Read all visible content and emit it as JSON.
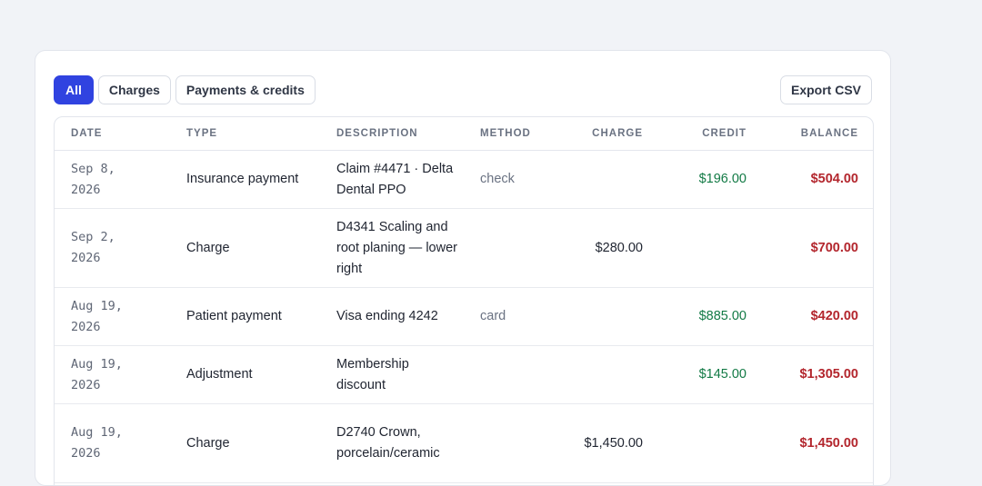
{
  "tabs": [
    {
      "label": "All",
      "active": true
    },
    {
      "label": "Charges",
      "active": false
    },
    {
      "label": "Payments & credits",
      "active": false
    }
  ],
  "export_label": "Export CSV",
  "columns": [
    "DATE",
    "TYPE",
    "DESCRIPTION",
    "METHOD",
    "CHARGE",
    "CREDIT",
    "BALANCE"
  ],
  "rows": [
    {
      "date": "Sep 8, 2026",
      "type": "Insurance payment",
      "description": "Claim #4471 · Delta Dental PPO",
      "method": "check",
      "charge": "",
      "credit": "$196.00",
      "balance": "$504.00"
    },
    {
      "date": "Sep 2, 2026",
      "type": "Charge",
      "description": "D4341 Scaling and root planing — lower right",
      "method": "",
      "charge": "$280.00",
      "credit": "",
      "balance": "$700.00"
    },
    {
      "date": "Aug 19, 2026",
      "type": "Patient payment",
      "description": "Visa ending 4242",
      "method": "card",
      "charge": "",
      "credit": "$885.00",
      "balance": "$420.00"
    },
    {
      "date": "Aug 19, 2026",
      "type": "Adjustment",
      "description": "Membership discount",
      "method": "",
      "charge": "",
      "credit": "$145.00",
      "balance": "$1,305.00"
    },
    {
      "date": "Aug 19, 2026",
      "type": "Charge",
      "description": "D2740 Crown, porcelain/ceramic",
      "method": "",
      "charge": "$1,450.00",
      "credit": "",
      "balance": "$1,450.00"
    }
  ],
  "colors": {
    "accent": "#3043e0",
    "credit": "#127a45",
    "balance": "#b3262d"
  }
}
